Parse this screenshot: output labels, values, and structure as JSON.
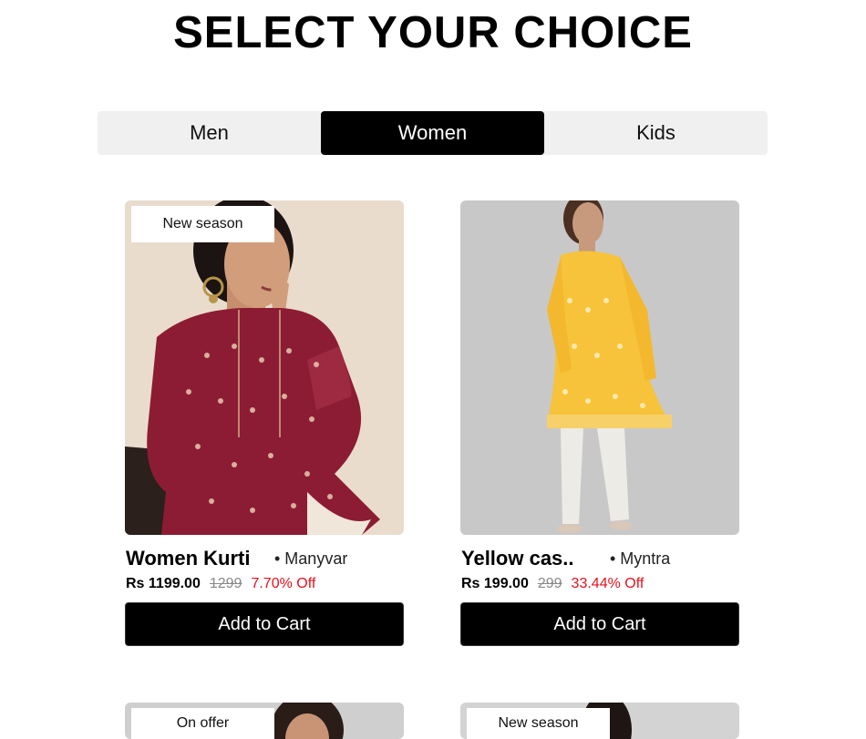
{
  "page": {
    "title": "SELECT YOUR CHOICE"
  },
  "tabs": [
    {
      "label": "Men"
    },
    {
      "label": "Women",
      "active": true
    },
    {
      "label": "Kids"
    }
  ],
  "products": [
    {
      "badge": "New season",
      "name": "Women Kurti",
      "brand": "• Manyvar",
      "price": "Rs 1199.00",
      "mrp": "1299",
      "discount": "7.70% Off",
      "button": "Add to Cart"
    },
    {
      "badge": "",
      "name": "Yellow cas..",
      "brand": "• Myntra",
      "price": "Rs 199.00",
      "mrp": "299",
      "discount": "33.44% Off",
      "button": "Add to Cart"
    },
    {
      "badge": "On offer"
    },
    {
      "badge": "New season"
    }
  ],
  "colors": {
    "accent": "#000000",
    "tab_bg": "#f0f0f0",
    "discount": "#e8101c"
  }
}
